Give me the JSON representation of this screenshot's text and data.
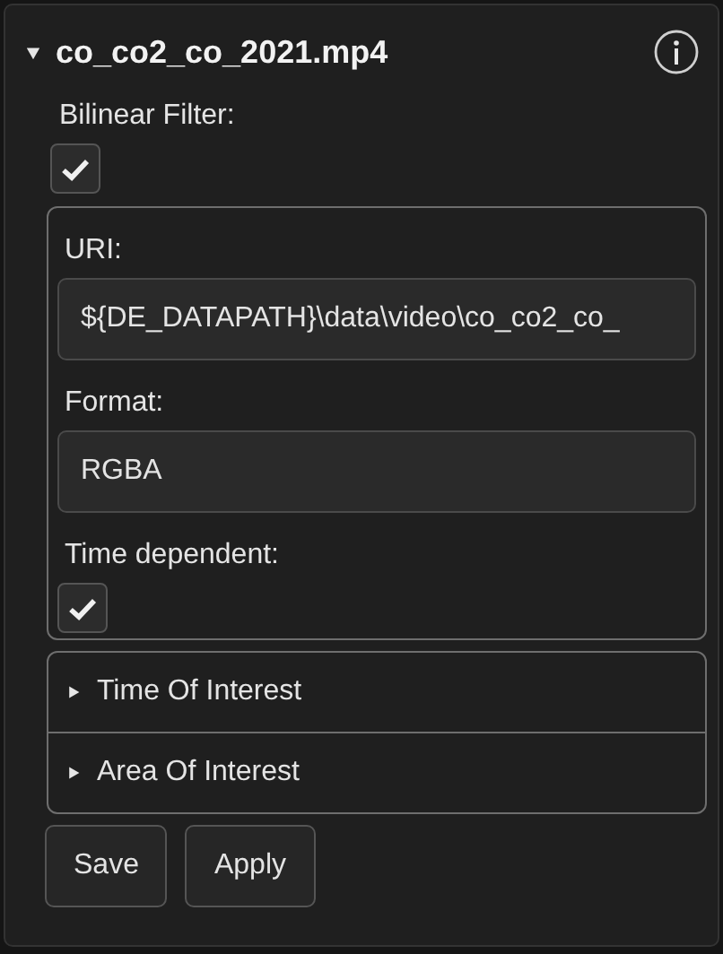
{
  "header": {
    "title": "co_co2_co_2021.mp4",
    "expanded": true
  },
  "bilinear_filter": {
    "label": "Bilinear Filter:",
    "checked": true
  },
  "fields": [
    {
      "label": "URI:",
      "value": "${DE_DATAPATH}\\data\\video\\co_co2_co_"
    },
    {
      "label": "Format:",
      "value": "RGBA"
    }
  ],
  "time_dependent": {
    "label": "Time dependent:",
    "checked": true
  },
  "sections": [
    {
      "label": "Time Of Interest",
      "expanded": false
    },
    {
      "label": "Area Of Interest",
      "expanded": false
    }
  ],
  "buttons": [
    "Save",
    "Apply"
  ]
}
